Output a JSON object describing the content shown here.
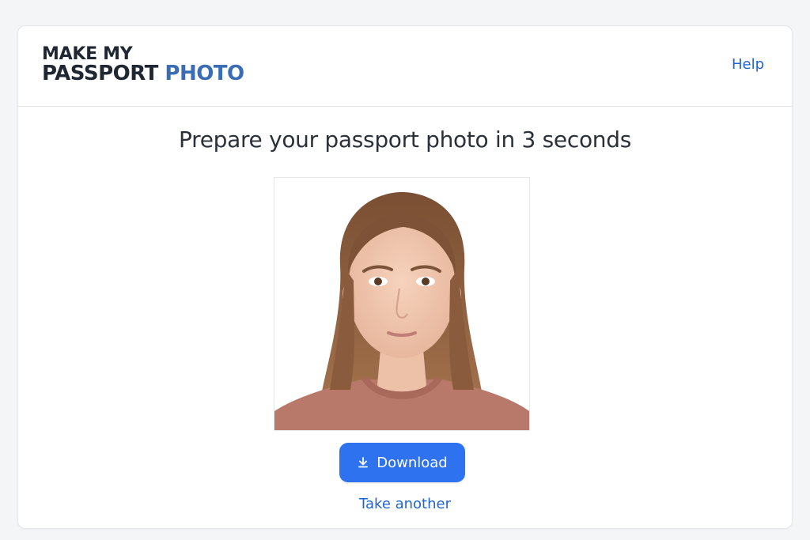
{
  "header": {
    "logo_line1": "MAKE MY",
    "logo_line2_main": "PASSPORT",
    "logo_line2_accent": "PHOTO",
    "help_label": "Help"
  },
  "main": {
    "title": "Prepare your passport photo in 3 seconds",
    "download_label": "Download",
    "take_another_label": "Take another"
  },
  "colors": {
    "accent": "#2e72f0",
    "link": "#1f63d6",
    "logo_accent": "#3a6db3",
    "text_dark": "#1f2733"
  },
  "icons": {
    "download": "download-icon"
  }
}
